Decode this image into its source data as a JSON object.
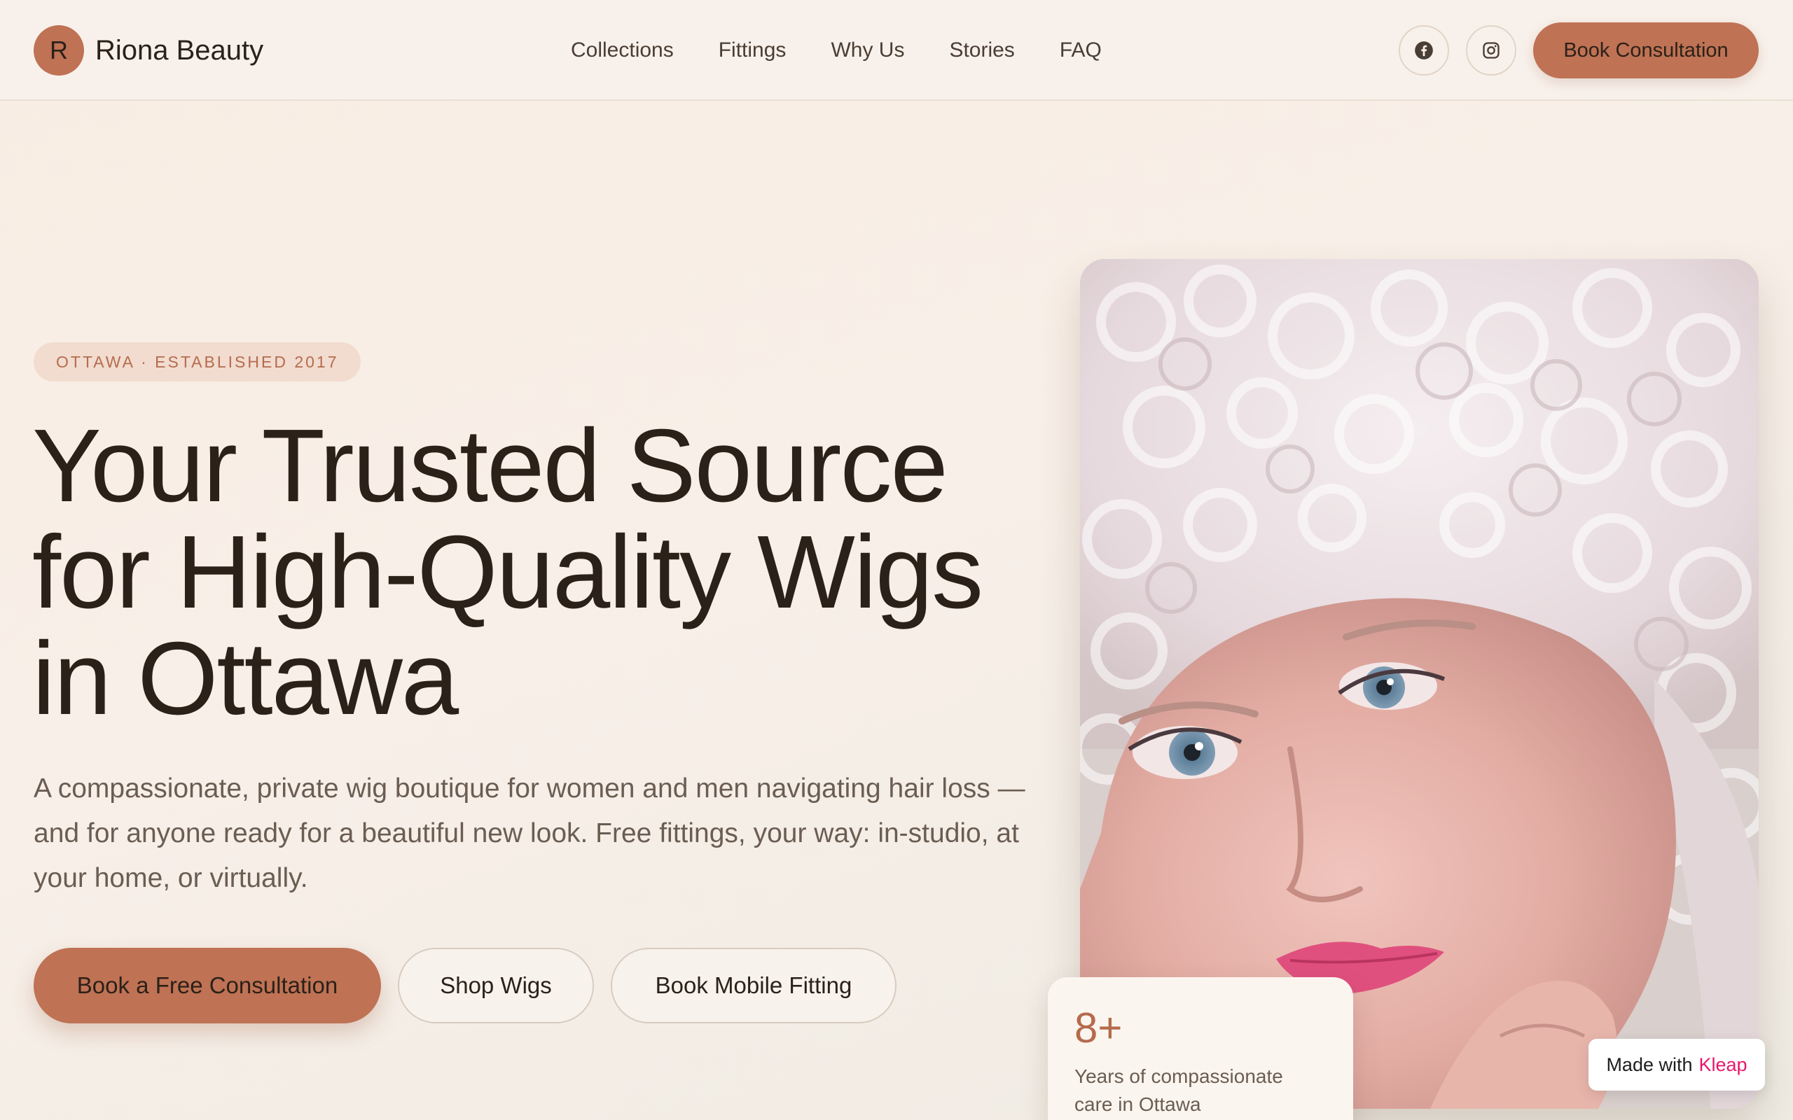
{
  "header": {
    "logo_letter": "R",
    "brand": "Riona Beauty",
    "nav": [
      "Collections",
      "Fittings",
      "Why Us",
      "Stories",
      "FAQ"
    ],
    "social": [
      "facebook-icon",
      "instagram-icon"
    ],
    "cta": "Book Consultation"
  },
  "hero": {
    "badge": "OTTAWA · ESTABLISHED 2017",
    "headline": "Your Trusted Source for High-Quality Wigs in Ottawa",
    "lead": "A compassionate, private wig boutique for women and men navigating hair loss — and for anyone ready for a beautiful new look. Free fittings, your way: in-studio, at your home, or virtually.",
    "buttons": {
      "primary": "Book a Free Consultation",
      "shop": "Shop Wigs",
      "mobile": "Book Mobile Fitting"
    }
  },
  "stat": {
    "value": "8+",
    "label": "Years of compassionate care in Ottawa"
  },
  "made_with": {
    "prefix": "Made with",
    "brand": "Kleap"
  },
  "colors": {
    "accent": "#bf7254",
    "accent_text": "#b66b4e",
    "background": "#f8efe8",
    "heading": "#2b2119",
    "body": "#6b5d52",
    "kleap": "#e5196b"
  }
}
